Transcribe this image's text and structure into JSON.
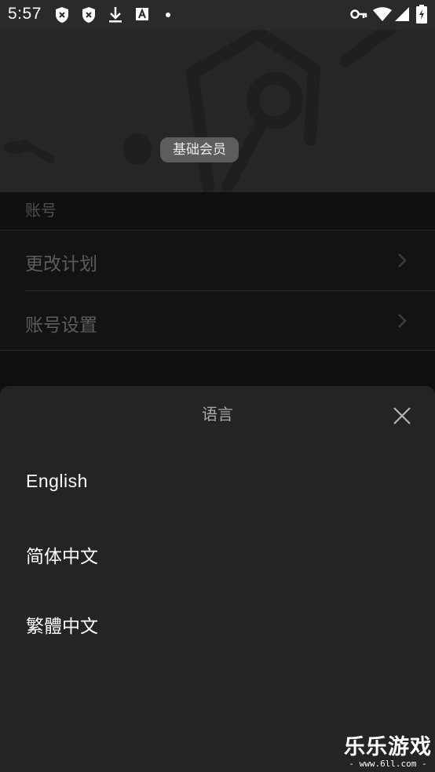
{
  "status_bar": {
    "time": "5:57"
  },
  "header": {
    "membership_badge": "基础会员"
  },
  "account": {
    "section_label": "账号",
    "items": [
      {
        "label": "更改计划"
      },
      {
        "label": "账号设置"
      }
    ]
  },
  "language_sheet": {
    "title": "语言",
    "options": [
      {
        "label": "English"
      },
      {
        "label": "简体中文"
      },
      {
        "label": "繁體中文"
      }
    ]
  },
  "watermark": {
    "main": "乐乐游戏",
    "sub": "- www.6ll.com -"
  }
}
